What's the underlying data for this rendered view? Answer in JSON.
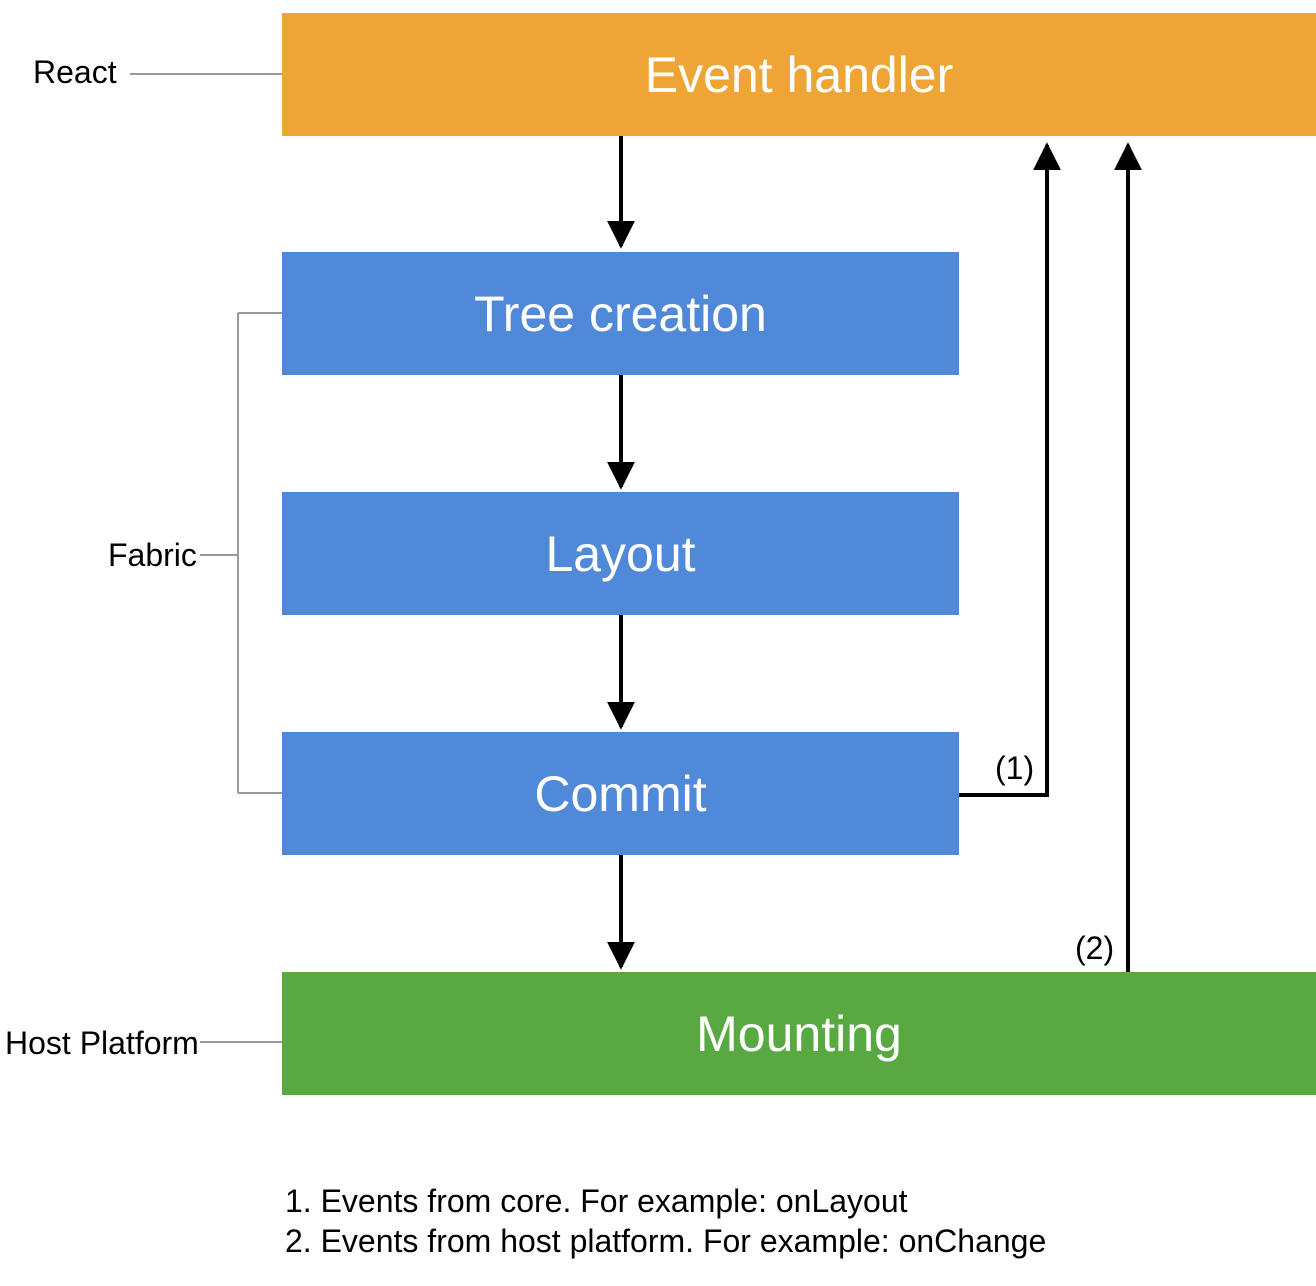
{
  "colors": {
    "orange": "#efa536",
    "blue": "#5089d8",
    "green": "#58a942",
    "line": "#999999",
    "arrow": "#000000"
  },
  "boxes": {
    "event_handler": "Event handler",
    "tree_creation": "Tree creation",
    "layout": "Layout",
    "commit": "Commit",
    "mounting": "Mounting"
  },
  "labels": {
    "react": "React",
    "fabric": "Fabric",
    "host_platform": "Host Platform"
  },
  "annotations": {
    "one": "(1)",
    "two": "(2)"
  },
  "footer": {
    "line1": "1. Events from core. For example: onLayout",
    "line2": "2. Events from host platform. For example: onChange"
  },
  "chart_data": {
    "type": "diagram",
    "nodes": [
      {
        "id": "event_handler",
        "label": "Event handler",
        "group": "React",
        "color": "orange"
      },
      {
        "id": "tree_creation",
        "label": "Tree creation",
        "group": "Fabric",
        "color": "blue"
      },
      {
        "id": "layout",
        "label": "Layout",
        "group": "Fabric",
        "color": "blue"
      },
      {
        "id": "commit",
        "label": "Commit",
        "group": "Fabric",
        "color": "blue"
      },
      {
        "id": "mounting",
        "label": "Mounting",
        "group": "Host Platform",
        "color": "green"
      }
    ],
    "groups": [
      {
        "name": "React",
        "nodes": [
          "event_handler"
        ]
      },
      {
        "name": "Fabric",
        "nodes": [
          "tree_creation",
          "layout",
          "commit"
        ]
      },
      {
        "name": "Host Platform",
        "nodes": [
          "mounting"
        ]
      }
    ],
    "edges": [
      {
        "from": "event_handler",
        "to": "tree_creation"
      },
      {
        "from": "tree_creation",
        "to": "layout"
      },
      {
        "from": "layout",
        "to": "commit"
      },
      {
        "from": "commit",
        "to": "mounting"
      },
      {
        "from": "commit",
        "to": "event_handler",
        "label": "(1)",
        "note": "Events from core. For example: onLayout"
      },
      {
        "from": "mounting",
        "to": "event_handler",
        "label": "(2)",
        "note": "Events from host platform. For example: onChange"
      }
    ]
  }
}
